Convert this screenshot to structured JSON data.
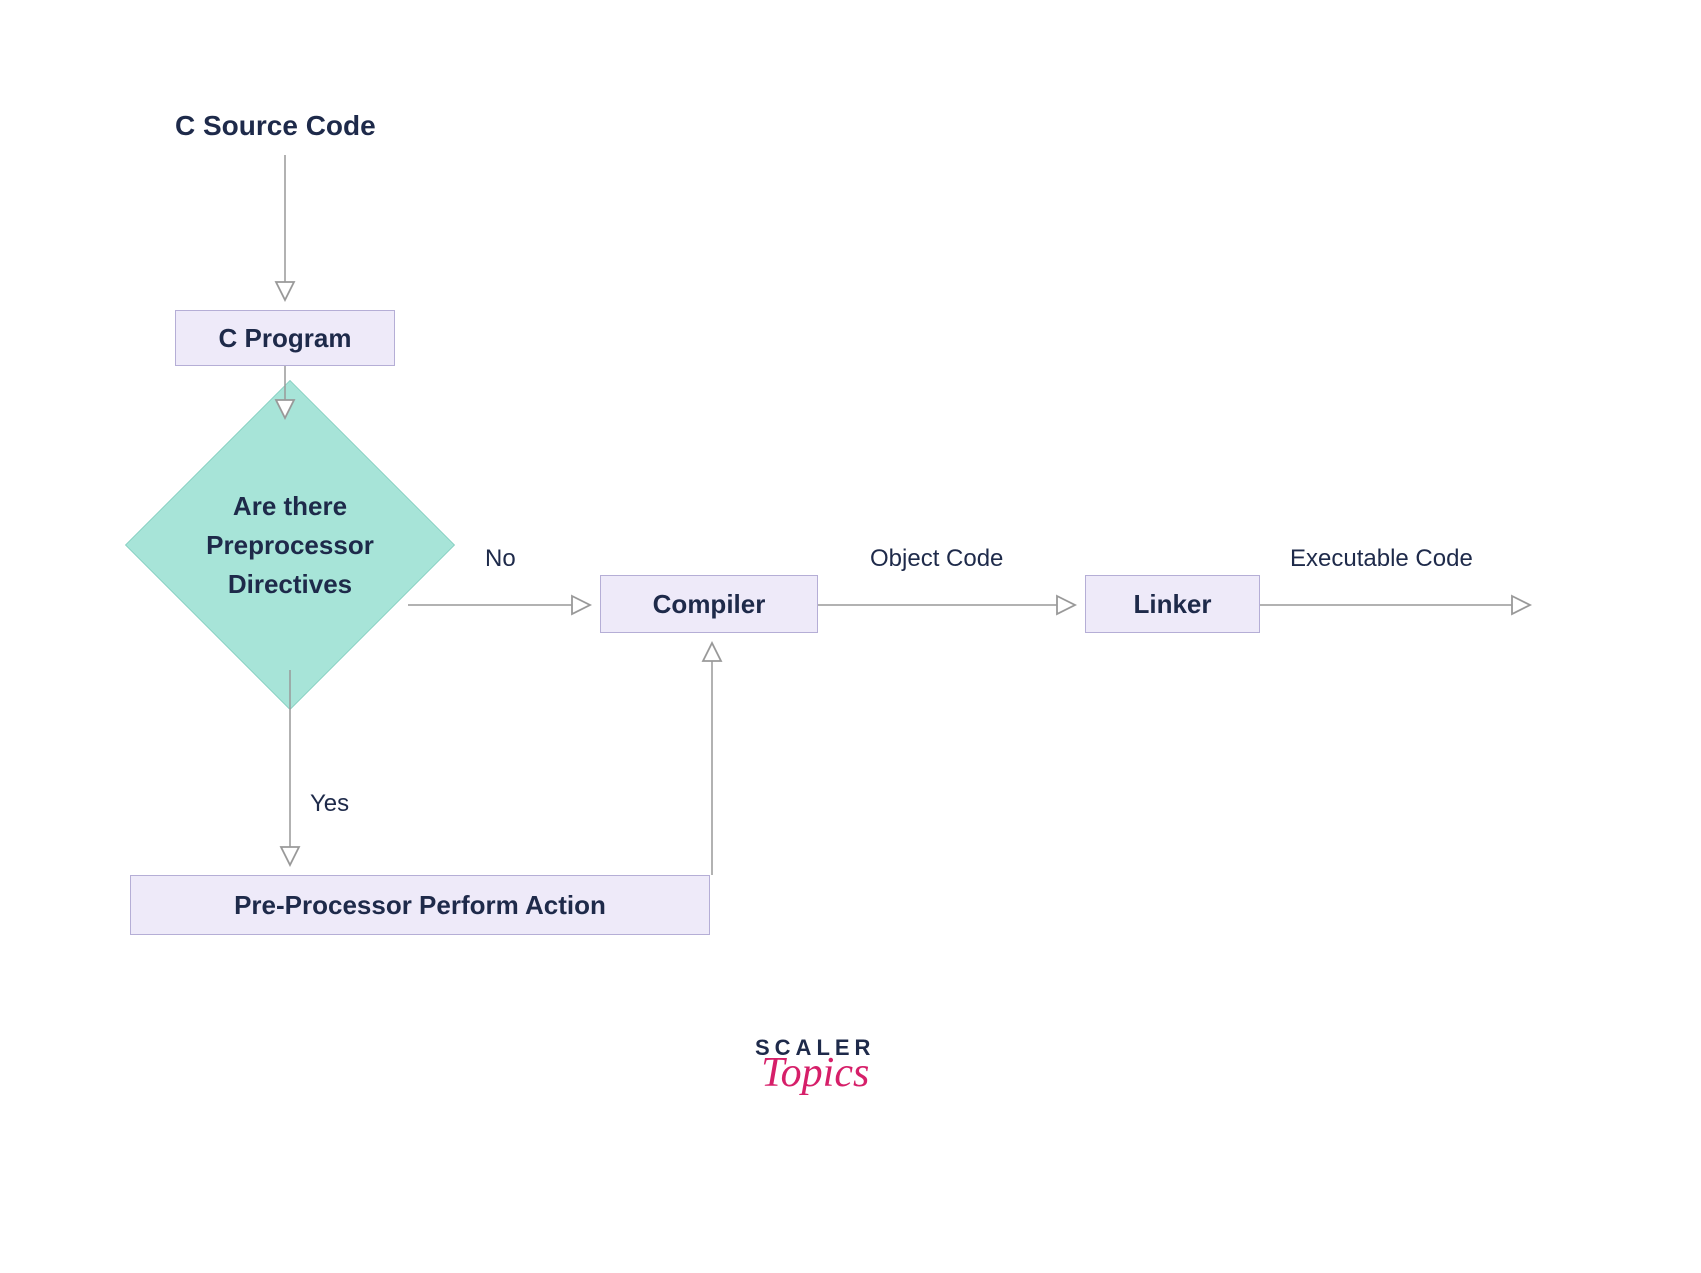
{
  "heading": "C Source Code",
  "nodes": {
    "c_program": "C Program",
    "decision": "Are there\nPreprocessor\nDirectives",
    "preprocessor": "Pre-Processor Perform Action",
    "compiler": "Compiler",
    "linker": "Linker"
  },
  "edges": {
    "no": "No",
    "yes": "Yes",
    "object_code": "Object Code",
    "executable_code": "Executable Code"
  },
  "logo": {
    "line1": "SCALER",
    "line2": "Topics"
  }
}
